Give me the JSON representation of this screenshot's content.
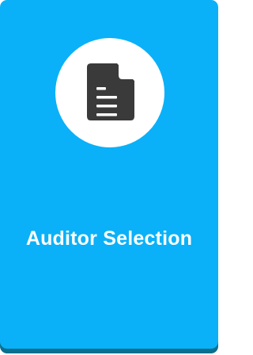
{
  "tile": {
    "label": "Auditor Selection",
    "icon": "document-icon",
    "colors": {
      "background": "#0ab1f8",
      "shadow": "#0b6f8e",
      "circle": "#ffffff",
      "icon": "#3a3a3a",
      "text": "#ffffff"
    }
  }
}
